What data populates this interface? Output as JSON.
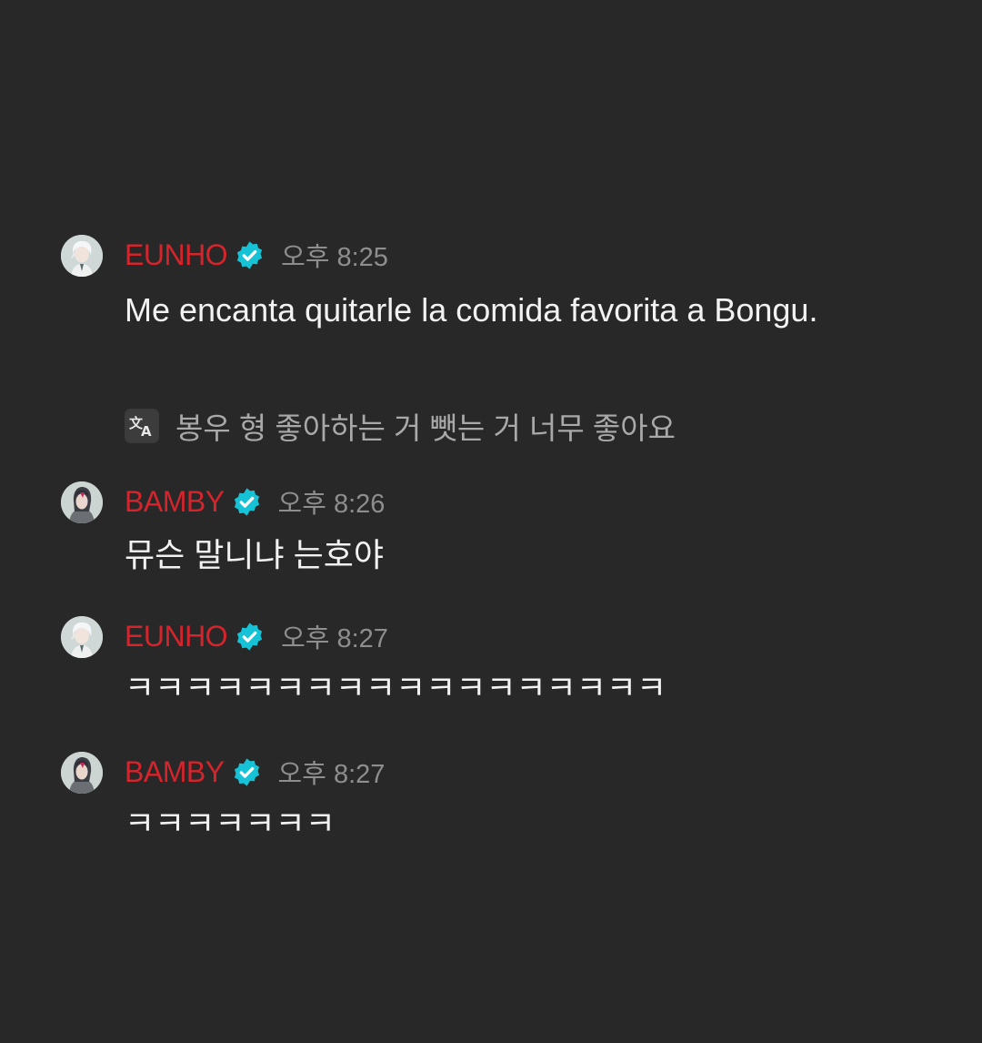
{
  "colors": {
    "background": "#282828",
    "name": "#d5242b",
    "badge": "#16c2d5",
    "time": "#8e8e8e",
    "text": "#f2f2f2",
    "translation": "#a9a9a9"
  },
  "messages": [
    {
      "author": "EUNHO",
      "verified_icon": "verified-badge-icon",
      "time": "오후 8:25",
      "text": "Me encanta quitarle la comida favorita a Bongu.",
      "translation_icon": "translate-icon",
      "translation": "봉우 형 좋아하는 거 뺏는 거 너무 좋아요"
    },
    {
      "author": "BAMBY",
      "verified_icon": "verified-badge-icon",
      "time": "오후 8:26",
      "text": "뮤슨 말니냐 는호야"
    },
    {
      "author": "EUNHO",
      "verified_icon": "verified-badge-icon",
      "time": "오후 8:27",
      "text": "ㅋㅋㅋㅋㅋㅋㅋㅋㅋㅋㅋㅋㅋㅋㅋㅋㅋㅋ"
    },
    {
      "author": "BAMBY",
      "verified_icon": "verified-badge-icon",
      "time": "오후 8:27",
      "text": "ㅋㅋㅋㅋㅋㅋㅋ"
    }
  ]
}
